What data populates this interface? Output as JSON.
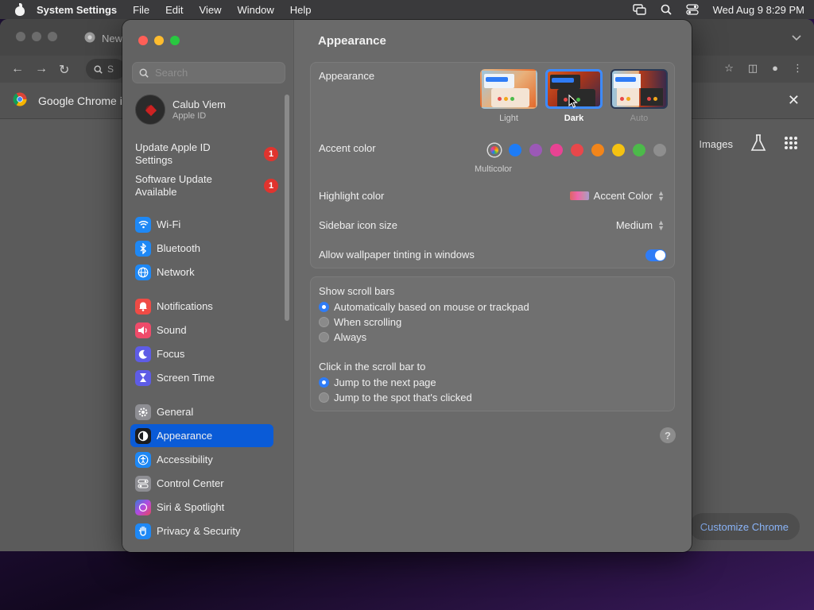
{
  "menubar": {
    "app_name": "System Settings",
    "menus": [
      "File",
      "Edit",
      "View",
      "Window",
      "Help"
    ],
    "clock": "Wed Aug 9  8:29 PM"
  },
  "chrome": {
    "tab_title": "New",
    "omnibox_text": "S",
    "infobar_text": "Google Chrome i",
    "images_link": "Images",
    "customize_label": "Customize Chrome"
  },
  "sidebar": {
    "search_placeholder": "Search",
    "profile": {
      "name": "Calub Viem",
      "subtitle": "Apple ID"
    },
    "notices": [
      {
        "label": "Update Apple ID Settings",
        "badge": "1"
      },
      {
        "label": "Software Update Available",
        "badge": "1"
      }
    ],
    "items": [
      {
        "label": "Wi-Fi",
        "icon": "wifi-icon",
        "color": "#1e88f5"
      },
      {
        "label": "Bluetooth",
        "icon": "bluetooth-icon",
        "color": "#1e88f5"
      },
      {
        "label": "Network",
        "icon": "globe-icon",
        "color": "#1e88f5"
      },
      {
        "label": "Notifications",
        "icon": "bell-icon",
        "color": "#ef4b45"
      },
      {
        "label": "Sound",
        "icon": "speaker-icon",
        "color": "#ef4b6a"
      },
      {
        "label": "Focus",
        "icon": "moon-icon",
        "color": "#5e5ce6"
      },
      {
        "label": "Screen Time",
        "icon": "hourglass-icon",
        "color": "#5e5ce6"
      },
      {
        "label": "General",
        "icon": "gear-icon",
        "color": "#8e8e93"
      },
      {
        "label": "Appearance",
        "icon": "appearance-icon",
        "color": "#1c1c1e"
      },
      {
        "label": "Accessibility",
        "icon": "accessibility-icon",
        "color": "#1e88f5"
      },
      {
        "label": "Control Center",
        "icon": "control-center-icon",
        "color": "#8e8e93"
      },
      {
        "label": "Siri & Spotlight",
        "icon": "siri-icon",
        "color": "#b24ae0"
      },
      {
        "label": "Privacy & Security",
        "icon": "hand-icon",
        "color": "#1e88f5"
      }
    ],
    "active": "Appearance"
  },
  "main": {
    "title": "Appearance",
    "appearance": {
      "label": "Appearance",
      "options": [
        "Light",
        "Dark",
        "Auto"
      ],
      "selected": "Dark"
    },
    "accent": {
      "label": "Accent color",
      "multicolor_caption": "Multicolor",
      "colors": [
        "#8e44ad",
        "#1e7cf6",
        "#9b59b6",
        "#e84393",
        "#e8474b",
        "#f2851a",
        "#f5c211",
        "#4cba4a",
        "#8e8e8e"
      ]
    },
    "highlight": {
      "label": "Highlight color",
      "value": "Accent Color"
    },
    "sidebar_icon_size": {
      "label": "Sidebar icon size",
      "value": "Medium"
    },
    "wallpaper_tinting": {
      "label": "Allow wallpaper tinting in windows",
      "enabled": true
    },
    "scroll_bars": {
      "label": "Show scroll bars",
      "options": [
        "Automatically based on mouse or trackpad",
        "When scrolling",
        "Always"
      ],
      "selected": "Automatically based on mouse or trackpad"
    },
    "click_scroll": {
      "label": "Click in the scroll bar to",
      "options": [
        "Jump to the next page",
        "Jump to the spot that's clicked"
      ],
      "selected": "Jump to the next page"
    },
    "help": "?"
  }
}
